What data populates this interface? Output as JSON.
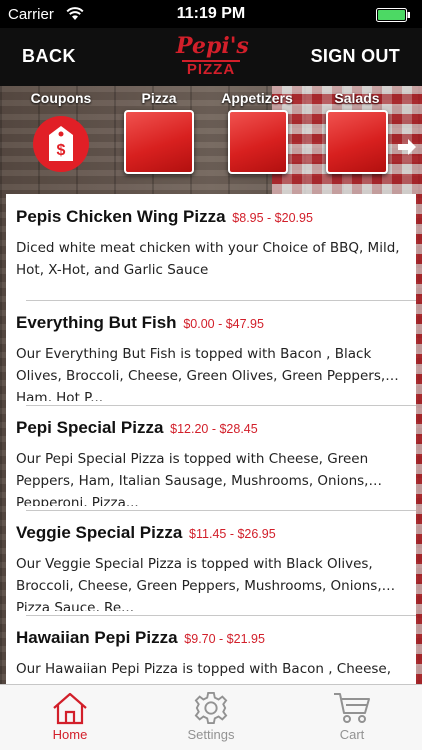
{
  "status_bar": {
    "carrier": "Carrier",
    "time": "11:19 PM"
  },
  "nav": {
    "back_label": "BACK",
    "signout_label": "SIGN OUT",
    "logo_script": "Pepi's",
    "logo_word": "PIZZA"
  },
  "categories": [
    {
      "label": "Coupons",
      "icon": "coupon-tag-icon"
    },
    {
      "label": "Pizza",
      "icon": "category-tile"
    },
    {
      "label": "Appetizers",
      "icon": "category-tile"
    },
    {
      "label": "Salads",
      "icon": "category-tile"
    }
  ],
  "menu": [
    {
      "name": "Pepis Chicken Wing Pizza",
      "price": "$8.95 - $20.95",
      "description": "Diced white meat chicken with your Choice of BBQ, Mild, Hot, X-Hot, and Garlic Sauce"
    },
    {
      "name": "Everything But Fish",
      "price": "$0.00 - $47.95",
      "description": "Our Everything But Fish is topped with Bacon , Black Olives, Broccoli, Cheese, Green Olives, Green Peppers, Ham, Hot P..."
    },
    {
      "name": "Pepi Special Pizza",
      "price": "$12.20 - $28.45",
      "description": "Our Pepi Special Pizza is topped with Cheese, Green Peppers, Ham, Italian Sausage, Mushrooms, Onions, Pepperoni, Pizza..."
    },
    {
      "name": "Veggie Special Pizza",
      "price": "$11.45 - $26.95",
      "description": "Our Veggie Special Pizza is topped with Black Olives, Broccoli, Cheese, Green Peppers, Mushrooms, Onions, Pizza Sauce, Re..."
    },
    {
      "name": "Hawaiian Pepi Pizza",
      "price": "$9.70 - $21.95",
      "description": "Our Hawaiian Pepi Pizza is topped with Bacon , Cheese, Ham..."
    }
  ],
  "tabs": [
    {
      "label": "Home",
      "icon": "home-icon",
      "active": true
    },
    {
      "label": "Settings",
      "icon": "gear-icon",
      "active": false
    },
    {
      "label": "Cart",
      "icon": "cart-icon",
      "active": false
    }
  ],
  "colors": {
    "accent": "#d21f2a",
    "nav_bg": "#0f0f0f",
    "tab_inactive": "#929292"
  }
}
